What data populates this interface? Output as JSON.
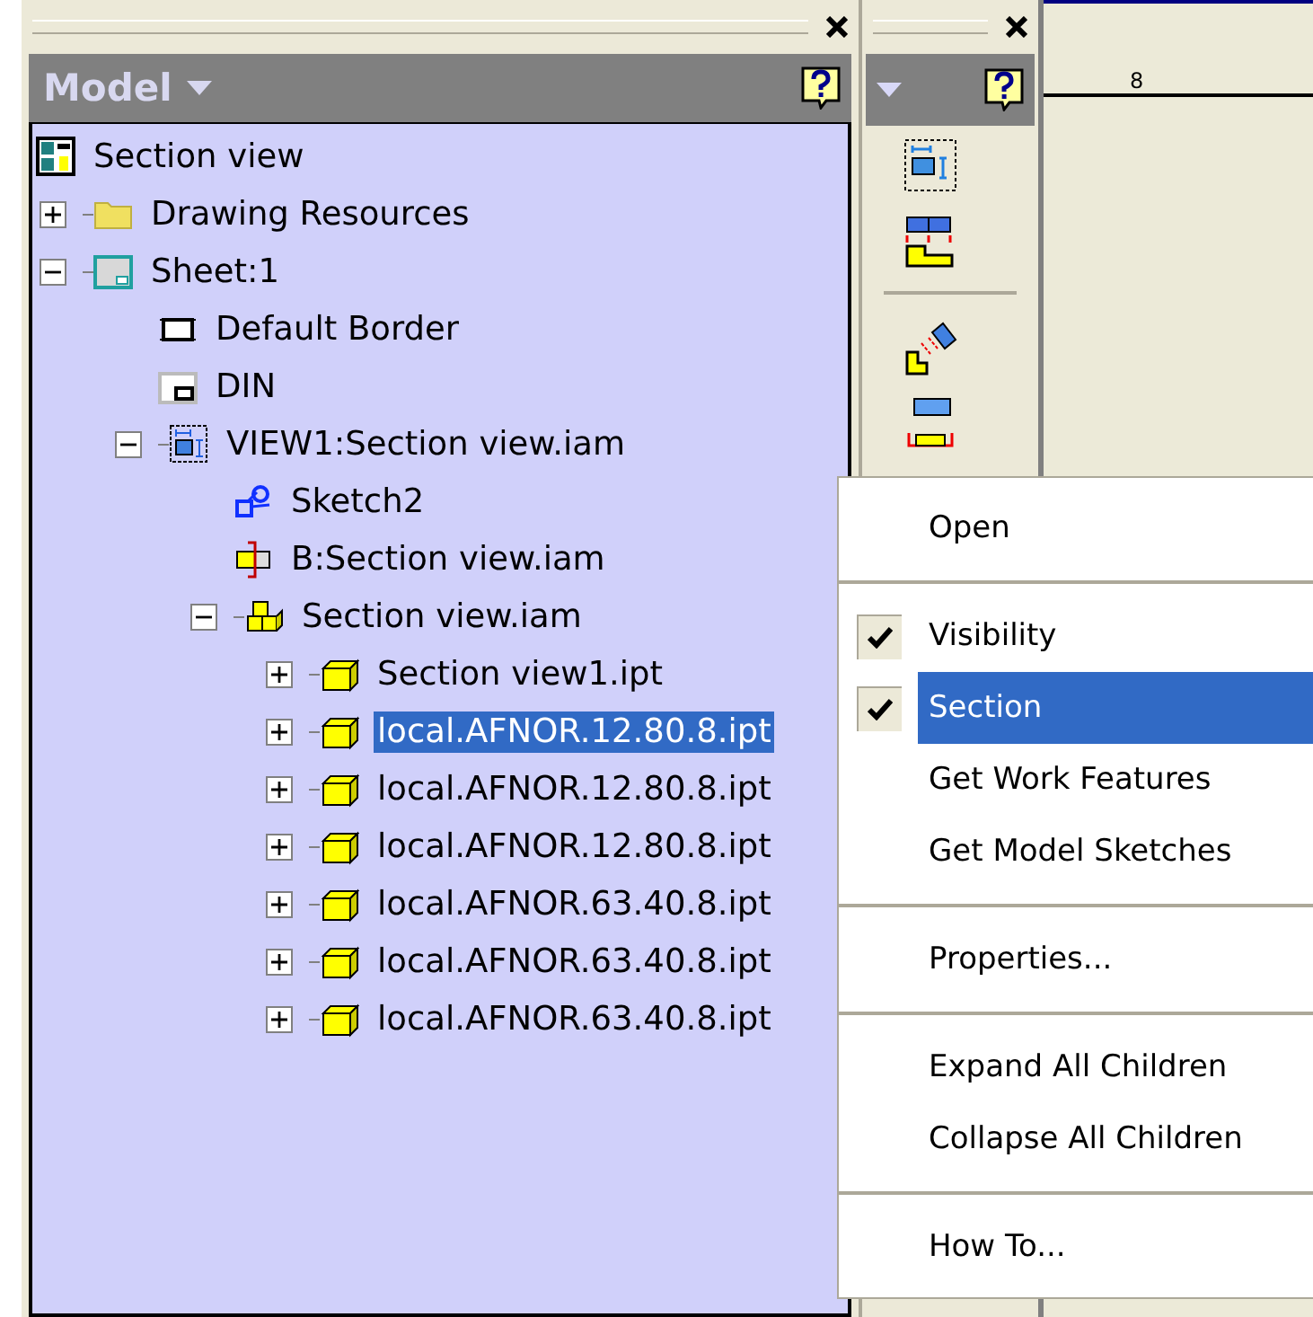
{
  "model_panel": {
    "title": "Model",
    "tree": [
      {
        "label": "Section view",
        "kind": "drawing",
        "selected": false,
        "children": [
          {
            "label": "Drawing Resources",
            "kind": "folder",
            "expanded": false,
            "selected": false
          },
          {
            "label": "Sheet:1",
            "kind": "sheet",
            "expanded": true,
            "selected": false,
            "children": [
              {
                "label": "Default Border",
                "kind": "border",
                "selected": false
              },
              {
                "label": "DIN",
                "kind": "titleblock",
                "selected": false
              },
              {
                "label": "VIEW1:Section view.iam",
                "kind": "view",
                "expanded": true,
                "selected": false,
                "children": [
                  {
                    "label": "Sketch2",
                    "kind": "sketch",
                    "selected": false
                  },
                  {
                    "label": "B:Section view.iam",
                    "kind": "break",
                    "selected": false
                  },
                  {
                    "label": "Section view.iam",
                    "kind": "assembly",
                    "expanded": true,
                    "selected": false,
                    "children": [
                      {
                        "label": "Section view1.ipt",
                        "kind": "part",
                        "expanded": false,
                        "selected": false
                      },
                      {
                        "label": "local.AFNOR.12.80.8.ipt",
                        "kind": "part",
                        "expanded": false,
                        "selected": true
                      },
                      {
                        "label": "local.AFNOR.12.80.8.ipt",
                        "kind": "part",
                        "expanded": false,
                        "selected": false
                      },
                      {
                        "label": "local.AFNOR.12.80.8.ipt",
                        "kind": "part",
                        "expanded": false,
                        "selected": false
                      },
                      {
                        "label": "local.AFNOR.63.40.8.ipt",
                        "kind": "part",
                        "expanded": false,
                        "selected": false
                      },
                      {
                        "label": "local.AFNOR.63.40.8.ipt",
                        "kind": "part",
                        "expanded": false,
                        "selected": false
                      },
                      {
                        "label": "local.AFNOR.63.40.8.ipt",
                        "kind": "part",
                        "expanded": false,
                        "selected": false
                      }
                    ]
                  }
                ]
              }
            ]
          }
        ]
      }
    ]
  },
  "toolbar": {
    "tools": [
      {
        "kind": "base"
      },
      {
        "kind": "projected"
      },
      {
        "kind": "auxiliary"
      },
      {
        "kind": "section"
      }
    ]
  },
  "canvas": {
    "ruler_label": "8"
  },
  "context_menu": [
    {
      "kind": "item",
      "label": "Open",
      "checked": false,
      "selected": false
    },
    {
      "kind": "separator"
    },
    {
      "kind": "item",
      "label": "Visibility",
      "checked": true,
      "selected": false
    },
    {
      "kind": "item",
      "label": "Section",
      "checked": true,
      "selected": true
    },
    {
      "kind": "item",
      "label": "Get Work Features",
      "checked": false,
      "selected": false
    },
    {
      "kind": "item",
      "label": "Get Model Sketches",
      "checked": false,
      "selected": false
    },
    {
      "kind": "separator"
    },
    {
      "kind": "item",
      "label": "Properties...",
      "checked": false,
      "selected": false
    },
    {
      "kind": "separator"
    },
    {
      "kind": "item",
      "label": "Expand All Children",
      "checked": false,
      "selected": false
    },
    {
      "kind": "item",
      "label": "Collapse All Children",
      "checked": false,
      "selected": false
    },
    {
      "kind": "separator"
    },
    {
      "kind": "item",
      "label": "How To...",
      "checked": false,
      "selected": false
    }
  ]
}
